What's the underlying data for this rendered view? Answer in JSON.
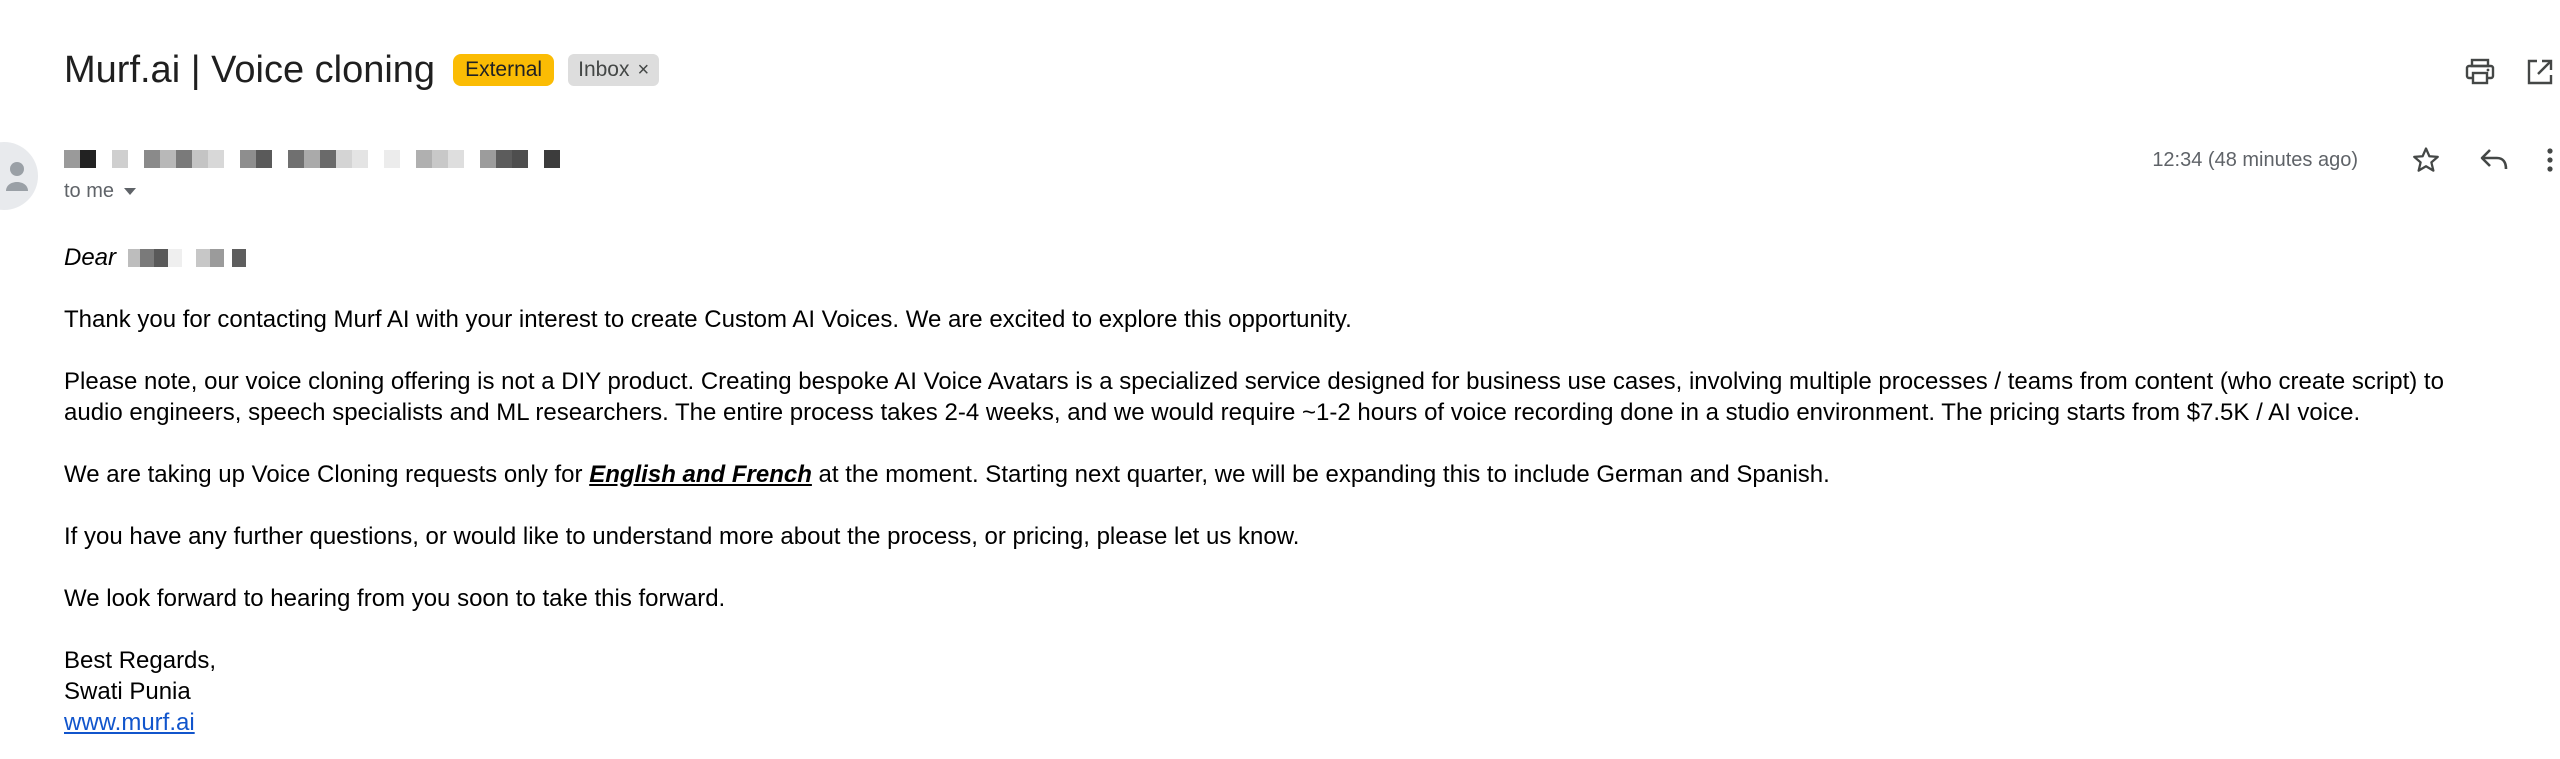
{
  "header": {
    "subject": "Murf.ai | Voice cloning",
    "labels": {
      "external": "External",
      "inbox": "Inbox",
      "inbox_remove": "×"
    },
    "actions": {
      "print_icon": "print-icon",
      "open_new_window_icon": "open-in-new-window-icon"
    }
  },
  "message": {
    "sender_redacted": true,
    "to_me": "to me",
    "timestamp": "12:34 (48 minutes ago)",
    "actions": {
      "star_icon": "star-icon",
      "reply_icon": "reply-icon",
      "more_icon": "more-vertical-icon"
    }
  },
  "body": {
    "greeting": "Dear",
    "p1": "Thank you for contacting Murf AI with your interest to create Custom AI Voices. We are excited to explore this opportunity.",
    "p2": "Please note, our voice cloning offering is not a DIY product. Creating bespoke AI Voice Avatars is a specialized service designed for business use cases, involving multiple processes / teams from content (who create script) to audio engineers, speech specialists and ML researchers. The entire process takes 2-4 weeks, and we would require ~1-2 hours of voice recording done in a studio environment. The pricing starts from $7.5K / AI voice.",
    "p3_before": "We are taking up Voice Cloning requests only for ",
    "p3_emph": "English and French",
    "p3_after": " at the moment. Starting next quarter, we will be expanding this to include German and Spanish.",
    "p4": "If you have any further questions, or would like to understand more about the process, or pricing, please let us know.",
    "p5": "We look forward to hearing from you soon to take this forward.",
    "signoff": "Best Regards,",
    "signer": "Swati Punia",
    "link": "www.murf.ai"
  },
  "colors": {
    "external_label": "#fbbc04",
    "inbox_label": "#dddddd",
    "link": "#1155cc",
    "meta_text": "#5f6368"
  }
}
